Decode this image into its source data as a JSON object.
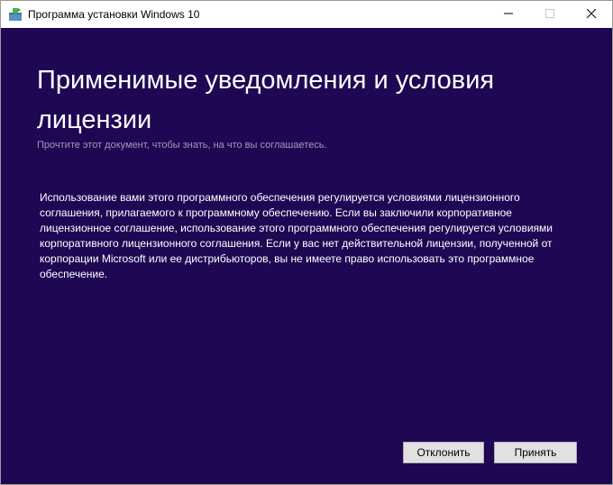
{
  "window": {
    "title": "Программа установки Windows 10",
    "controls": {
      "minimize": "minimize-icon",
      "maximize": "maximize-icon",
      "close": "close-icon"
    }
  },
  "page": {
    "heading": "Применимые уведомления и условия лицензии",
    "subtitle": "Прочтите этот документ, чтобы знать, на что вы соглашаетесь.",
    "terms_text": "Использование вами этого программного обеспечения регулируется условиями лицензионного соглашения, прилагаемого к программному обеспечению. Если вы заключили корпоративное лицензионное соглашение, использование этого программного обеспечения регулируется условиями корпоративного лицензионного соглашения. Если у вас нет действительной лицензии, полученной от корпорации Microsoft или ее дистрибьюторов, вы не имеете право использовать это программное обеспечение."
  },
  "buttons": {
    "decline": "Отклонить",
    "accept": "Принять"
  },
  "colors": {
    "background": "#1f0754",
    "titlebar": "#ffffff",
    "text": "#ffffff",
    "subtitle": "#a49ab9",
    "button_bg": "#e1e1e1"
  }
}
